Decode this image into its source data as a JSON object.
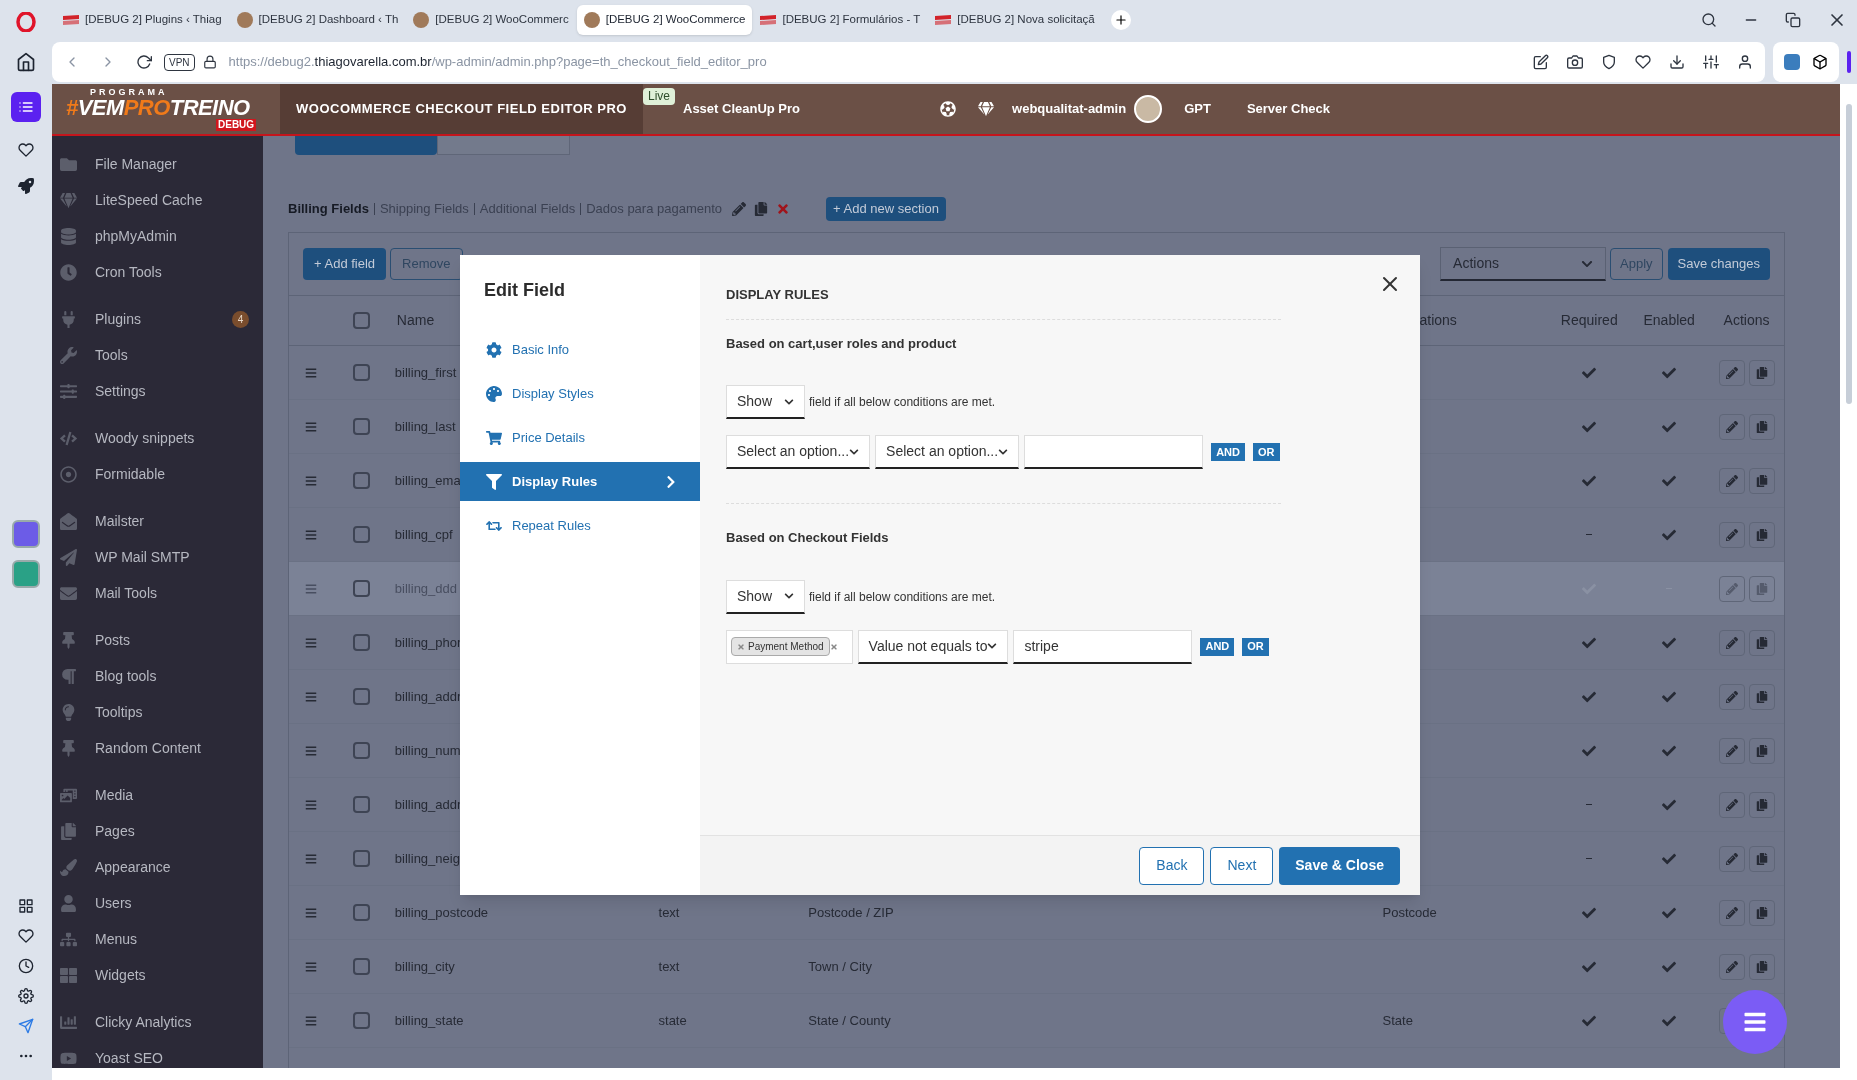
{
  "browser": {
    "tabs": [
      {
        "title": "[DEBUG 2] Plugins ‹ Thiag",
        "kind": "flag",
        "selected": false
      },
      {
        "title": "[DEBUG 2] Dashboard ‹ Th",
        "kind": "photo",
        "selected": false
      },
      {
        "title": "[DEBUG 2] WooCommerc",
        "kind": "photo",
        "selected": false
      },
      {
        "title": "[DEBUG 2] WooCommerce",
        "kind": "photo",
        "selected": true
      },
      {
        "title": "[DEBUG 2] Formulários - T",
        "kind": "flag",
        "selected": false
      },
      {
        "title": "[DEBUG 2] Nova solicitaçã",
        "kind": "flag",
        "selected": false
      }
    ],
    "vpn": "VPN",
    "url": {
      "prefix": "https://debug2.",
      "domain": "thiagovarella.com.br",
      "path": "/wp-admin/admin.php?page=th_checkout_field_editor_pro"
    }
  },
  "admin_bar": {
    "logo": {
      "top": "PROGRAMA",
      "parts": [
        {
          "text": "#",
          "accent": true
        },
        {
          "text": "VEM",
          "accent": false
        },
        {
          "text": "PRO",
          "accent": true
        },
        {
          "text": "TREINO",
          "accent": false
        }
      ],
      "badge": "DEBUG"
    },
    "plugin_title": "WOOCOMMERCE CHECKOUT FIELD EDITOR PRO",
    "live_badge": "Live",
    "plugin_link": "Asset CleanUp Pro",
    "user": "webqualitat-admin",
    "links": [
      "GPT",
      "Server Check"
    ]
  },
  "sidebar": {
    "groups": [
      {
        "items": [
          {
            "label": "File Manager"
          },
          {
            "label": "LiteSpeed Cache"
          },
          {
            "label": "phpMyAdmin"
          },
          {
            "label": "Cron Tools"
          }
        ]
      },
      {
        "items": [
          {
            "label": "Plugins",
            "badge": "4"
          },
          {
            "label": "Tools"
          },
          {
            "label": "Settings"
          }
        ]
      },
      {
        "items": [
          {
            "label": "Woody snippets"
          },
          {
            "label": "Formidable"
          }
        ]
      },
      {
        "items": [
          {
            "label": "Mailster"
          },
          {
            "label": "WP Mail SMTP"
          },
          {
            "label": "Mail Tools"
          }
        ]
      },
      {
        "items": [
          {
            "label": "Posts"
          },
          {
            "label": "Blog tools"
          },
          {
            "label": "Tooltips"
          },
          {
            "label": "Random Content"
          }
        ]
      },
      {
        "items": [
          {
            "label": "Media"
          },
          {
            "label": "Pages"
          },
          {
            "label": "Appearance"
          },
          {
            "label": "Users"
          },
          {
            "label": "Menus"
          },
          {
            "label": "Widgets"
          }
        ]
      },
      {
        "items": [
          {
            "label": "Clicky Analytics"
          },
          {
            "label": "Yoast SEO"
          }
        ]
      }
    ]
  },
  "sections": [
    {
      "label": "Billing Fields",
      "selected": true
    },
    {
      "label": "Shipping Fields",
      "selected": false
    },
    {
      "label": "Additional Fields",
      "selected": false
    },
    {
      "label": "Dados para pagamento",
      "selected": false
    }
  ],
  "add_section": "+ Add new section",
  "toolbar": {
    "add": "+ Add field",
    "remove": "Remove",
    "actions": "Actions",
    "apply": "Apply",
    "save": "Save changes"
  },
  "table": {
    "header": {
      "checked": false,
      "name": "Name",
      "column_5": "ations",
      "required": "Required",
      "enabled": "Enabled",
      "actions": "Actions"
    },
    "rows": [
      {
        "name": "billing_first",
        "checked": false,
        "disabled": false,
        "required": true,
        "enabled": true
      },
      {
        "name": "billing_last",
        "checked": false,
        "disabled": false,
        "required": true,
        "enabled": true
      },
      {
        "name": "billing_ema",
        "checked": false,
        "disabled": false,
        "required": true,
        "enabled": true
      },
      {
        "name": "billing_cpf",
        "checked": false,
        "disabled": false,
        "required": false,
        "enabled": true
      },
      {
        "name": "billing_ddd",
        "checked": false,
        "disabled": true,
        "required": true,
        "enabled": false
      },
      {
        "name": "billing_phor",
        "checked": false,
        "disabled": false,
        "required": true,
        "enabled": true
      },
      {
        "name": "billing_addr",
        "checked": false,
        "disabled": false,
        "required": true,
        "enabled": true
      },
      {
        "name": "billing_num",
        "checked": false,
        "disabled": false,
        "required": true,
        "enabled": true
      },
      {
        "name": "billing_addr",
        "checked": false,
        "disabled": false,
        "required": false,
        "enabled": true
      },
      {
        "name": "billing_neig",
        "checked": false,
        "disabled": false,
        "required": false,
        "enabled": true
      },
      {
        "name": "billing_postcode",
        "type": "text",
        "label": "Postcode / ZIP",
        "column_5": "Postcode",
        "checked": false,
        "disabled": false,
        "required": true,
        "enabled": true
      },
      {
        "name": "billing_city",
        "type": "text",
        "label": "Town / City",
        "checked": false,
        "disabled": false,
        "required": true,
        "enabled": true
      },
      {
        "name": "billing_state",
        "type": "state",
        "label": "State / County",
        "column_5": "State",
        "checked": false,
        "disabled": false,
        "required": true,
        "enabled": true
      }
    ]
  },
  "modal": {
    "title": "Edit Field",
    "nav": [
      {
        "label": "Basic Info",
        "kind": "gear",
        "selected": false
      },
      {
        "label": "Display Styles",
        "kind": "palette",
        "selected": false
      },
      {
        "label": "Price Details",
        "kind": "cart",
        "selected": false
      },
      {
        "label": "Display Rules",
        "kind": "filter",
        "selected": true
      },
      {
        "label": "Repeat Rules",
        "kind": "repeat",
        "selected": false
      }
    ],
    "heading": "DISPLAY RULES",
    "sections": [
      {
        "title": "Based on cart,user roles and product",
        "mode": "Show",
        "mode_text": "field if all below conditions are met.",
        "conditions": [
          {
            "field": {
              "kind": "select",
              "placeholder": "Select an option..."
            },
            "operator": {
              "placeholder": "Select an option..."
            },
            "and": "AND",
            "or": "OR"
          }
        ]
      },
      {
        "title": "Based on Checkout Fields",
        "mode": "Show",
        "mode_text": "field if all below conditions are met.",
        "conditions": [
          {
            "field": {
              "kind": "tags",
              "tags": [
                "Payment Method"
              ]
            },
            "operator": {
              "value": "Value not equals to"
            },
            "value": "stripe",
            "and": "AND",
            "or": "OR"
          }
        ]
      }
    ],
    "buttons": [
      {
        "label": "Back",
        "kind": "secondary"
      },
      {
        "label": "Next",
        "kind": "secondary"
      },
      {
        "label": "Save & Close",
        "kind": "primary"
      }
    ]
  }
}
